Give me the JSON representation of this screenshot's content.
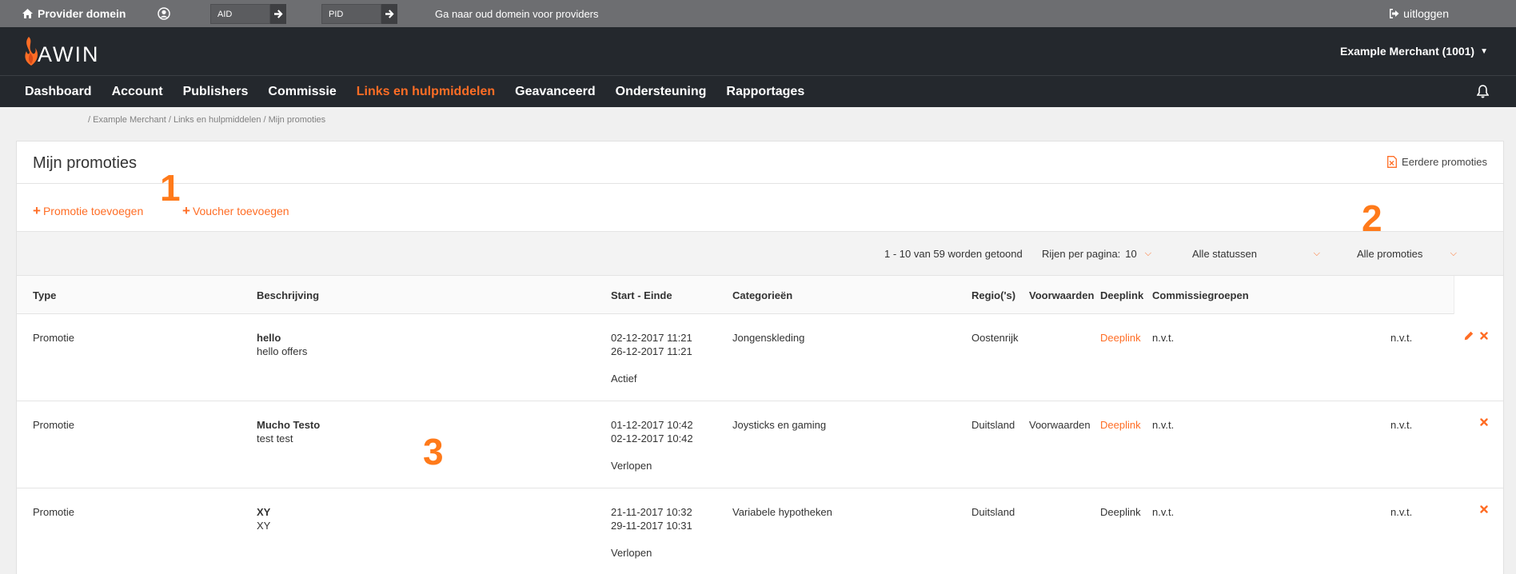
{
  "provider_bar": {
    "home_label": "Provider domein",
    "aid_placeholder": "AID",
    "pid_placeholder": "PID",
    "old_domain_label": "Ga naar oud domein voor providers",
    "logout_label": "uitloggen"
  },
  "header": {
    "logo_text": "AWIN",
    "merchant_label": "Example Merchant (1001)"
  },
  "nav": {
    "items": [
      "Dashboard",
      "Account",
      "Publishers",
      "Commissie",
      "Links en hulpmiddelen",
      "Geavanceerd",
      "Ondersteuning",
      "Rapportages"
    ],
    "active_index": 4
  },
  "breadcrumb": "/ Example Merchant / Links en hulpmiddelen / Mijn promoties",
  "panel": {
    "title": "Mijn promoties",
    "previous_link": "Eerdere promoties",
    "add_promotion": "Promotie toevoegen",
    "add_voucher": "Voucher toevoegen"
  },
  "filters": {
    "count_text": "1 - 10 van 59 worden getoond",
    "rows_label": "Rijen per pagina:",
    "rows_value": "10",
    "status_value": "Alle statussen",
    "promo_value": "Alle promoties"
  },
  "table": {
    "headers": {
      "type": "Type",
      "description": "Beschrijving",
      "dates": "Start - Einde",
      "categories": "Categorieën",
      "regions": "Regio('s)",
      "conditions": "Voorwaarden",
      "deeplink": "Deeplink",
      "commission": "Commissiegroepen"
    },
    "rows": [
      {
        "type": "Promotie",
        "title": "hello",
        "subtitle": "hello offers",
        "start": "02-12-2017 11:21",
        "end": "26-12-2017 11:21",
        "status": "Actief",
        "category": "Jongenskleding",
        "region": "Oostenrijk",
        "conditions": "",
        "deeplink": "Deeplink",
        "commission": "n.v.t.",
        "extra": "n.v.t."
      },
      {
        "type": "Promotie",
        "title": "Mucho Testo",
        "subtitle": "test test",
        "start": "01-12-2017 10:42",
        "end": "02-12-2017 10:42",
        "status": "Verlopen",
        "category": "Joysticks en gaming",
        "region": "Duitsland",
        "conditions": "Voorwaarden",
        "deeplink": "Deeplink",
        "commission": "n.v.t.",
        "extra": "n.v.t."
      },
      {
        "type": "Promotie",
        "title": "XY",
        "subtitle": "XY",
        "start": "21-11-2017 10:32",
        "end": "29-11-2017 10:31",
        "status": "Verlopen",
        "category": "Variabele hypotheken",
        "region": "Duitsland",
        "conditions": "",
        "deeplink": "Deeplink",
        "commission": "n.v.t.",
        "extra": "n.v.t."
      }
    ]
  },
  "annotations": [
    "1",
    "2",
    "3"
  ],
  "colors": {
    "accent": "#ff6d25",
    "header_bg": "#24282d",
    "provider_bg": "#6d6e71"
  }
}
